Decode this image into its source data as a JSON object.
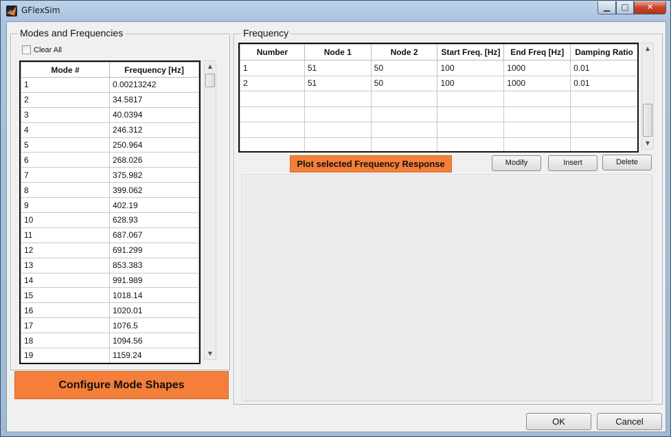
{
  "window": {
    "title": "GFlexSim"
  },
  "titlebar_buttons": {
    "minimize": "▁",
    "maximize": "□",
    "close": "✕"
  },
  "modes_panel": {
    "title": "Modes and Frequencies",
    "clear_all_label": "Clear All",
    "columns": [
      "Mode #",
      "Frequency [Hz]"
    ],
    "rows": [
      [
        "1",
        "0.00213242"
      ],
      [
        "2",
        "34.5817"
      ],
      [
        "3",
        "40.0394"
      ],
      [
        "4",
        "246.312"
      ],
      [
        "5",
        "250.964"
      ],
      [
        "6",
        "268.026"
      ],
      [
        "7",
        "375.982"
      ],
      [
        "8",
        "399.062"
      ],
      [
        "9",
        "402.19"
      ],
      [
        "10",
        "628.93"
      ],
      [
        "11",
        "687.067"
      ],
      [
        "12",
        "691.299"
      ],
      [
        "13",
        "853.383"
      ],
      [
        "14",
        "991.989"
      ],
      [
        "15",
        "1018.14"
      ],
      [
        "16",
        "1020.01"
      ],
      [
        "17",
        "1076.5"
      ],
      [
        "18",
        "1094.56"
      ],
      [
        "19",
        "1159.24"
      ]
    ],
    "configure_button": "Configure Mode Shapes"
  },
  "frequency_panel": {
    "title": "Frequency",
    "columns": [
      "Number",
      "Node 1",
      "Node 2",
      "Start Freq. [Hz]",
      "End Freq [Hz]",
      "Damping Ratio"
    ],
    "rows": [
      [
        "1",
        "51",
        "50",
        "100",
        "1000",
        "0.01"
      ],
      [
        "2",
        "51",
        "50",
        "100",
        "1000",
        "0.01"
      ],
      [
        "",
        "",
        "",
        "",
        "",
        ""
      ],
      [
        "",
        "",
        "",
        "",
        "",
        ""
      ],
      [
        "",
        "",
        "",
        "",
        "",
        ""
      ],
      [
        "",
        "",
        "",
        "",
        "",
        ""
      ]
    ],
    "plot_button": "Plot selected Frequency Response",
    "modify_button": "Modify",
    "insert_button": "Insert",
    "delete_button": "Delete"
  },
  "footer": {
    "ok_button": "OK",
    "cancel_button": "Cancel"
  },
  "colors": {
    "accent_orange": "#f47f3a"
  }
}
